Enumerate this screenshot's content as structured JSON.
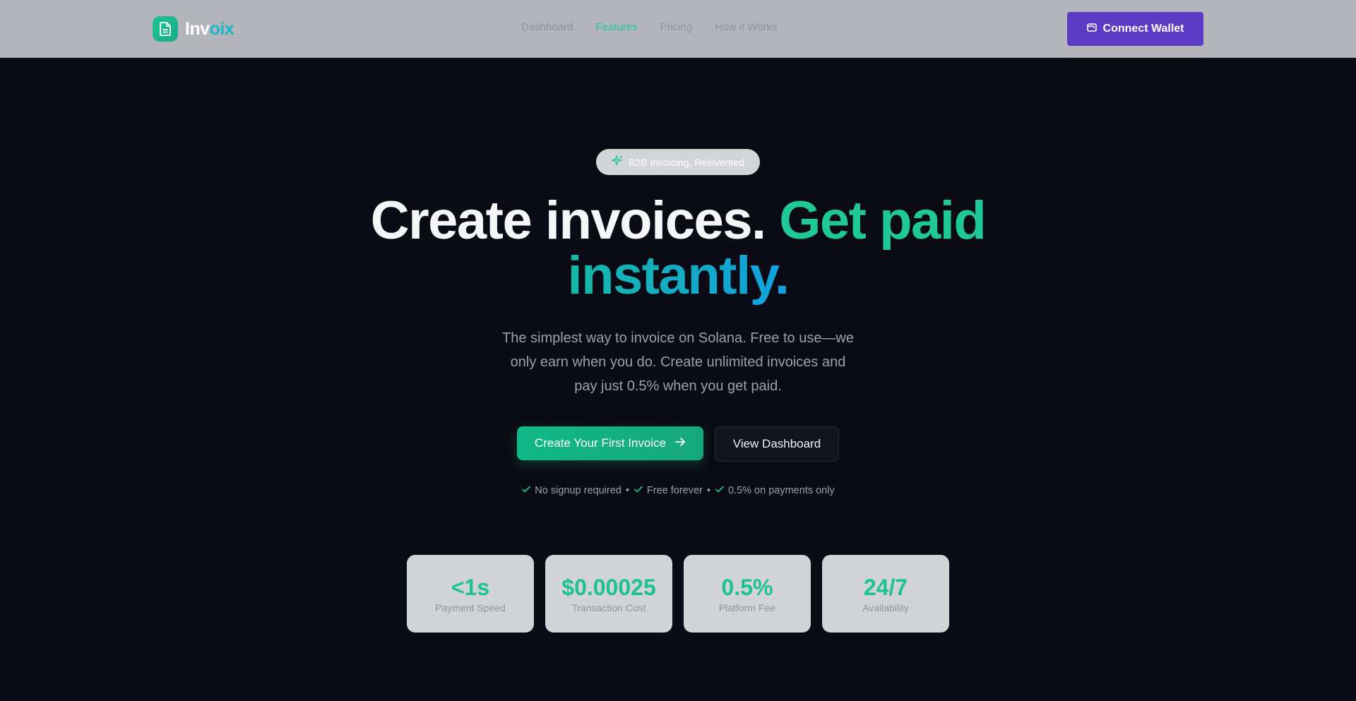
{
  "brand": {
    "name_a": "Inv",
    "name_b": "oix",
    "icon": "document-icon"
  },
  "nav": {
    "items": [
      {
        "label": "Dashboard",
        "active": false
      },
      {
        "label": "Features",
        "active": true
      },
      {
        "label": "Pricing",
        "active": false
      },
      {
        "label": "How it Works",
        "active": false
      }
    ]
  },
  "header": {
    "connect_label": "Connect Wallet",
    "connect_icon": "wallet-icon"
  },
  "hero": {
    "badge": "B2B Invoicing, Reinvented",
    "badge_icon": "sparkle-icon",
    "headline_white": "Create invoices.",
    "headline_green": "Get paid",
    "headline_cyan": "instantly.",
    "subtitle": "The simplest way to invoice on Solana. Free to use—we only earn when you do. Create unlimited invoices and pay just 0.5% when you get paid.",
    "primary_cta": "Create Your First Invoice",
    "secondary_cta": "View Dashboard",
    "checks": [
      "No signup required",
      "Free forever",
      "0.5% on payments only"
    ],
    "separator": "•"
  },
  "stats": [
    {
      "value": "<1s",
      "label": "Payment Speed"
    },
    {
      "value": "$0.00025",
      "label": "Transaction Cost"
    },
    {
      "value": "0.5%",
      "label": "Platform Fee"
    },
    {
      "value": "24/7",
      "label": "Availability"
    }
  ],
  "colors": {
    "accent_green": "#1fc997",
    "accent_cyan": "#1bb8c9",
    "wallet_purple": "#5b3bc4",
    "background": "#0a0b14"
  }
}
